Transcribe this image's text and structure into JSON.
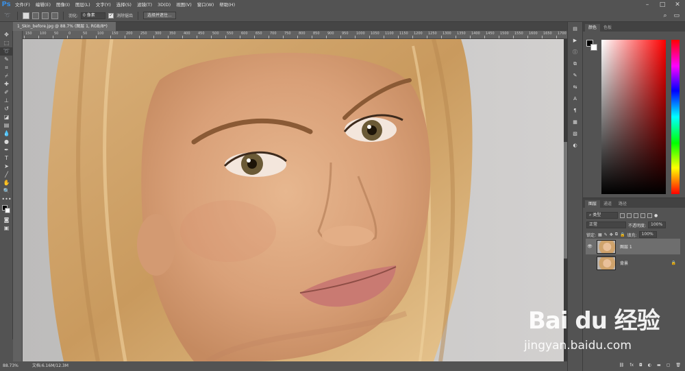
{
  "menubar": {
    "logo": "Ps",
    "items": [
      "文件(F)",
      "编辑(E)",
      "图像(I)",
      "图层(L)",
      "文字(Y)",
      "选择(S)",
      "滤镜(T)",
      "3D(D)",
      "视图(V)",
      "窗口(W)",
      "帮助(H)"
    ]
  },
  "options": {
    "feather_label": "羽化:",
    "feather_value": "0 像素",
    "antialias_label": "消除锯齿",
    "select_mask_label": "选择并遮住..."
  },
  "document": {
    "tab_title": "1_Skin_before.jpg @ 88.7% (图层 1, RGB/8*) *",
    "ruler_ticks": [
      "150",
      "100",
      "50",
      "0",
      "50",
      "100",
      "150",
      "200",
      "250",
      "300",
      "350",
      "400",
      "450",
      "500",
      "550",
      "600",
      "650",
      "700",
      "750",
      "800",
      "850",
      "900",
      "950",
      "1000",
      "1050",
      "1100",
      "1150",
      "1200",
      "1250",
      "1300",
      "1350",
      "1400",
      "1450",
      "1500",
      "1550",
      "1600",
      "1650",
      "1700",
      "1750"
    ]
  },
  "status": {
    "zoom": "88.73%",
    "doc_size": "文档:6.16M/12.3M"
  },
  "color_panel": {
    "tabs": [
      "颜色",
      "色板"
    ],
    "fg_color": "#000000",
    "bg_color": "#ffffff"
  },
  "layers_panel": {
    "tabs": [
      "图层",
      "通道",
      "路径"
    ],
    "filter_kind": "类型",
    "blend_mode": "正常",
    "opacity_label": "不透明度:",
    "opacity_value": "100%",
    "lock_label": "锁定:",
    "fill_label": "填充:",
    "fill_value": "100%",
    "layers": [
      {
        "name": "图层 1",
        "selected": true,
        "visible": true
      },
      {
        "name": "背景",
        "selected": false,
        "visible": false,
        "locked": true
      }
    ]
  },
  "watermark": {
    "brand": "Bai du 经验",
    "url": "jingyan.baidu.com"
  }
}
